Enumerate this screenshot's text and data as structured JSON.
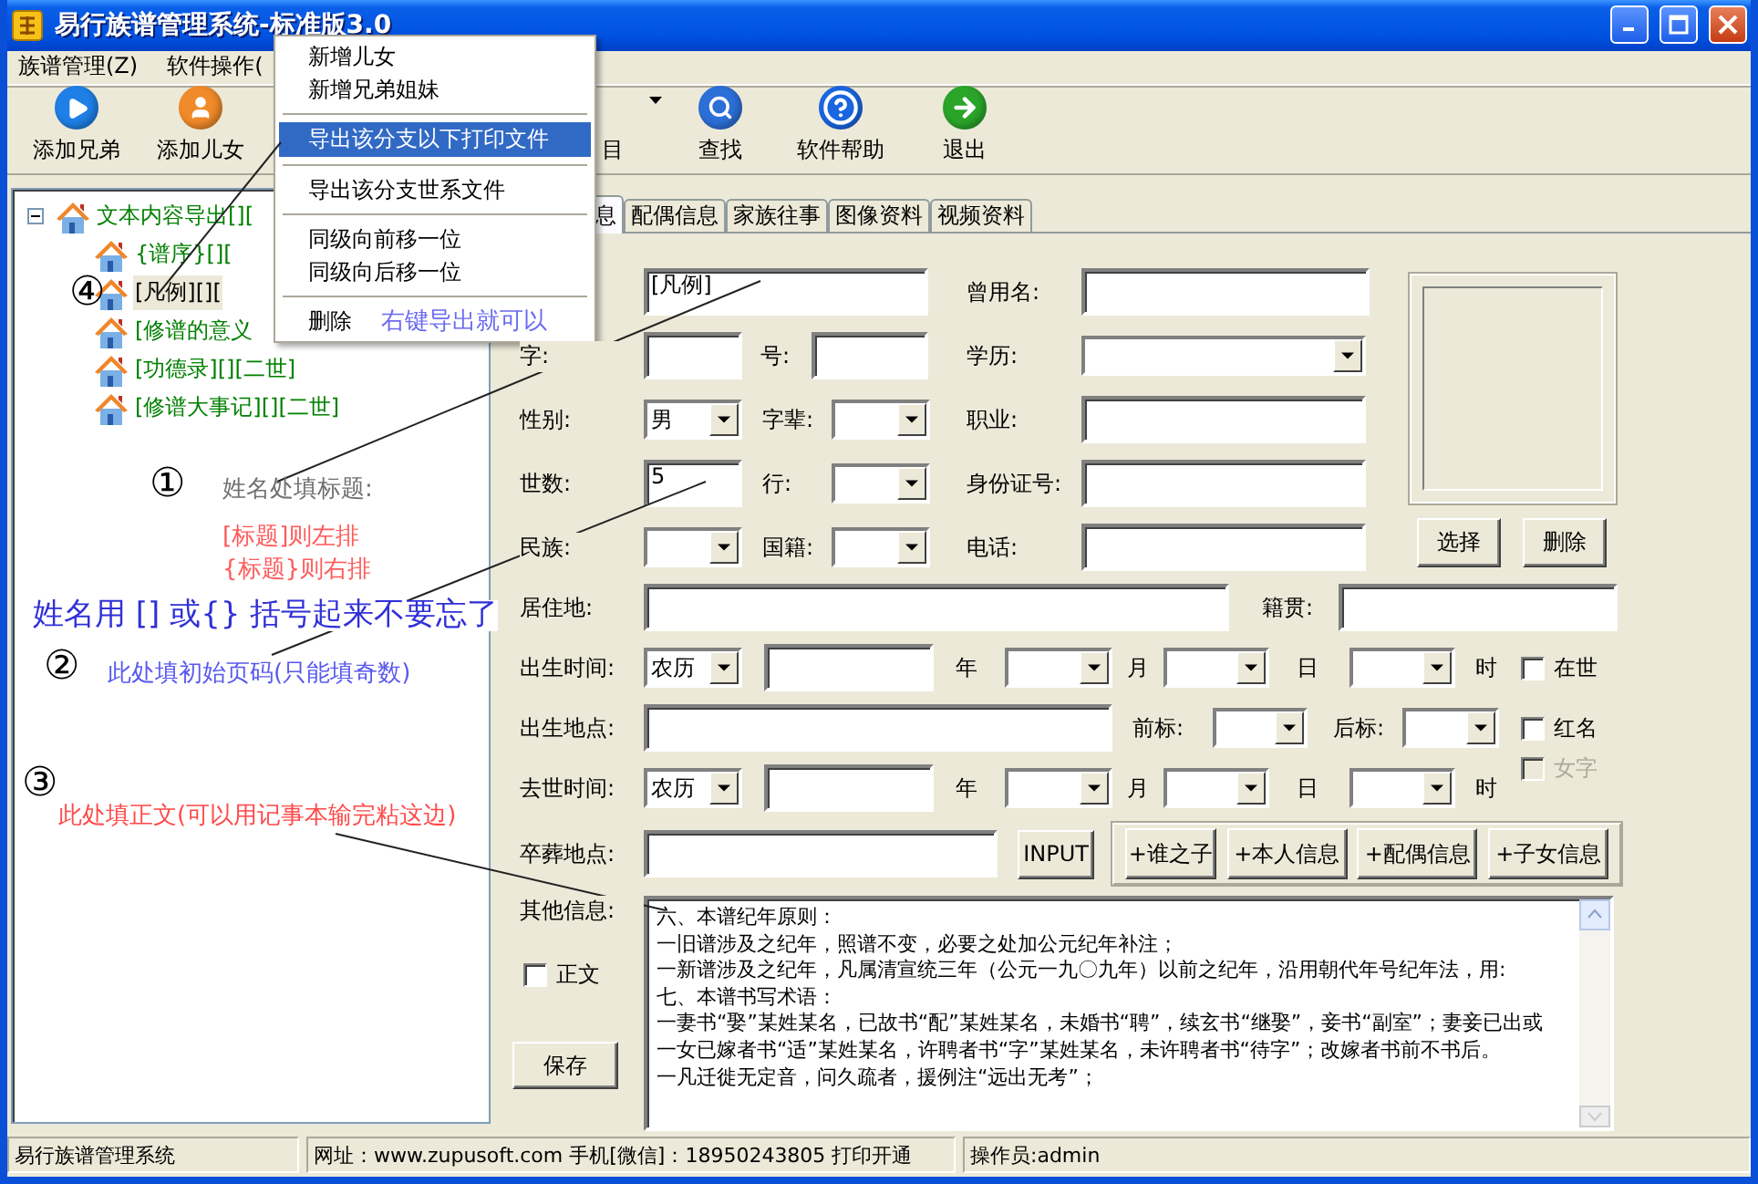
{
  "window": {
    "title": "易行族谱管理系统-标准版3.0"
  },
  "menu": [
    {
      "label": "族谱管理(Z)"
    },
    {
      "label": "软件操作("
    }
  ],
  "toolbar": [
    {
      "label": "添加兄弟",
      "kind": "play"
    },
    {
      "label": "添加儿女",
      "kind": "person"
    },
    {
      "label": "目",
      "kind": "dropdown"
    },
    {
      "label": "查找",
      "kind": "search"
    },
    {
      "label": "软件帮助",
      "kind": "help"
    },
    {
      "label": "退出",
      "kind": "exit"
    }
  ],
  "tree": {
    "label": "文本内容导出[][",
    "expanded": true,
    "selected": false,
    "children": [
      {
        "label": "{谱序}[][",
        "selected": false
      },
      {
        "label": "[凡例][][",
        "selected": true
      },
      {
        "label": "[修谱的意义",
        "selected": false
      },
      {
        "label": "[功德录][][二世]",
        "selected": false
      },
      {
        "label": "[修谱大事记][][二世]",
        "selected": false
      }
    ]
  },
  "context_menu": {
    "items": [
      {
        "kind": "item",
        "label": "新增儿女",
        "selected": false
      },
      {
        "kind": "item",
        "label": "新增兄弟姐妹",
        "selected": false
      },
      {
        "kind": "separator"
      },
      {
        "kind": "item",
        "label": "导出该分支以下打印文件",
        "selected": true
      },
      {
        "kind": "separator"
      },
      {
        "kind": "item",
        "label": "导出该分支世系文件",
        "selected": false
      },
      {
        "kind": "separator"
      },
      {
        "kind": "item",
        "label": "同级向前移一位",
        "selected": false
      },
      {
        "kind": "item",
        "label": "同级向后移一位",
        "selected": false
      },
      {
        "kind": "separator"
      },
      {
        "kind": "item",
        "label": "删除",
        "selected": false,
        "note": "右键导出就可以"
      }
    ]
  },
  "annotations": [
    {
      "kind": "circled",
      "text": "④"
    },
    {
      "kind": "circled",
      "text": "①"
    },
    {
      "kind": "note",
      "text": "姓名处填标题:",
      "color": "#707070"
    },
    {
      "kind": "note",
      "text": "[标题]则左排",
      "color": "#ff5a5a"
    },
    {
      "kind": "note",
      "text": "{标题}则右排",
      "color": "#ff5a5a"
    },
    {
      "kind": "big_note",
      "text": "姓名用 [] 或{} 括号起来不要忘了",
      "color": "#3030d8"
    },
    {
      "kind": "circled",
      "text": "②"
    },
    {
      "kind": "note",
      "text": "此处填初始页码(只能填奇数)",
      "color": "#5858ee"
    },
    {
      "kind": "circled",
      "text": "③"
    },
    {
      "kind": "note",
      "text": "此处填正文(可以用记事本输完粘这边)",
      "color": "#ff4a4a"
    }
  ],
  "tabs": [
    {
      "label": "息",
      "selected": true
    },
    {
      "label": "配偶信息",
      "selected": false
    },
    {
      "label": "家族往事",
      "selected": false
    },
    {
      "label": "图像资料",
      "selected": false
    },
    {
      "label": "视频资料",
      "selected": false
    }
  ],
  "form": {
    "name": {
      "value": "[凡例]"
    },
    "former_name": {
      "label": "曾用名:"
    },
    "courtesy": {
      "label": "字:"
    },
    "art_name": {
      "label": "号:"
    },
    "education": {
      "label": "学历:"
    },
    "gender": {
      "label": "性别:",
      "value": "男"
    },
    "generation_char": {
      "label": "字辈:"
    },
    "occupation": {
      "label": "职业:"
    },
    "generation": {
      "label": "世数:",
      "value": "5"
    },
    "rank": {
      "label": "行:"
    },
    "id_number": {
      "label": "身份证号:"
    },
    "ethnicity": {
      "label": "民族:"
    },
    "nationality": {
      "label": "国籍:"
    },
    "phone": {
      "label": "电话:"
    },
    "photo_buttons": [
      "选择",
      "删除"
    ],
    "residence": {
      "label": "居住地:"
    },
    "native_place": {
      "label": "籍贯:"
    },
    "birth": {
      "label": "出生时间:",
      "calendar": "农历",
      "year": "年",
      "month": "月",
      "day": "日",
      "hour": "时"
    },
    "alive": {
      "label": "在世",
      "checked": false,
      "disabled": false
    },
    "birthplace": {
      "label": "出生地点:"
    },
    "prefix": {
      "label": "前标:"
    },
    "suffix": {
      "label": "后标:"
    },
    "red_name": {
      "label": "红名",
      "checked": false,
      "disabled": false
    },
    "female": {
      "label": "女字",
      "checked": false,
      "disabled": true
    },
    "death": {
      "label": "去世时间:",
      "calendar": "农历",
      "year": "年",
      "month": "月",
      "day": "日",
      "hour": "时"
    },
    "burial": {
      "label": "卒葬地点:"
    },
    "input_button": "INPUT",
    "add_buttons": [
      "+谁之子",
      "+本人信息",
      "+配偶信息",
      "+子女信息"
    ],
    "other": {
      "label": "其他信息:",
      "lines": [
        "六、本谱纪年原则：",
        "一旧谱涉及之纪年，照谱不变，必要之处加公元纪年补注；",
        "一新谱涉及之纪年，凡属清宣统三年（公元一九〇九年）以前之纪年，沿用朝代年号纪年法，用:",
        "七、本谱书写术语：",
        "一妻书“娶”某姓某名，已故书“配”某姓某名，未婚书“聘”，续玄书“继娶”，妾书“副室”；妻妾已出或",
        "一女已嫁者书“适”某姓某名，许聘者书“字”某姓某名，未许聘者书“待字”；改嫁者书前不书后。",
        "一凡迁徙无定音，问久疏者，援例注“远出无考”；"
      ]
    },
    "body_text": {
      "label": "正文",
      "checked": false,
      "disabled": false
    },
    "save": "保存"
  },
  "status_bar": [
    "易行族谱管理系统",
    "网址：www.zupusoft.com 手机[微信]：18950243805 打印开通",
    "操作员:admin"
  ]
}
